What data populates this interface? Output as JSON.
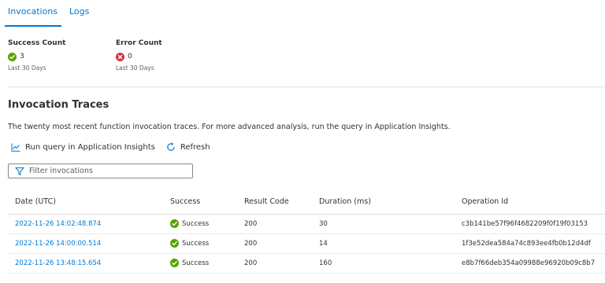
{
  "tabs": [
    {
      "label": "Invocations",
      "active": true
    },
    {
      "label": "Logs",
      "active": false
    }
  ],
  "metrics": {
    "success": {
      "title": "Success Count",
      "value": "3",
      "period": "Last 30 Days",
      "color": "#57a300"
    },
    "error": {
      "title": "Error Count",
      "value": "0",
      "period": "Last 30 Days",
      "color": "#d13438"
    }
  },
  "section": {
    "title": "Invocation Traces",
    "description": "The twenty most recent function invocation traces. For more advanced analysis, run the query in Application Insights."
  },
  "actions": {
    "run_query_label": "Run query in Application Insights",
    "refresh_label": "Refresh"
  },
  "filter": {
    "placeholder": "Filter invocations",
    "value": ""
  },
  "table": {
    "headers": [
      "Date (UTC)",
      "Success",
      "Result Code",
      "Duration (ms)",
      "Operation Id"
    ],
    "rows": [
      {
        "date": "2022-11-26 14:02:48.874",
        "success": "Success",
        "code": "200",
        "duration": "30",
        "op": "c3b141be57f96f4682209f0f19f03153"
      },
      {
        "date": "2022-11-26 14:00:00.514",
        "success": "Success",
        "code": "200",
        "duration": "14",
        "op": "1f3e52dea584a74c893ee4fb0b12d4df"
      },
      {
        "date": "2022-11-26 13:48:15.654",
        "success": "Success",
        "code": "200",
        "duration": "160",
        "op": "e8b7f66deb354a09988e96920b09c8b7"
      }
    ]
  },
  "colors": {
    "accent": "#0078d4",
    "success": "#57a300",
    "error": "#d13438"
  }
}
